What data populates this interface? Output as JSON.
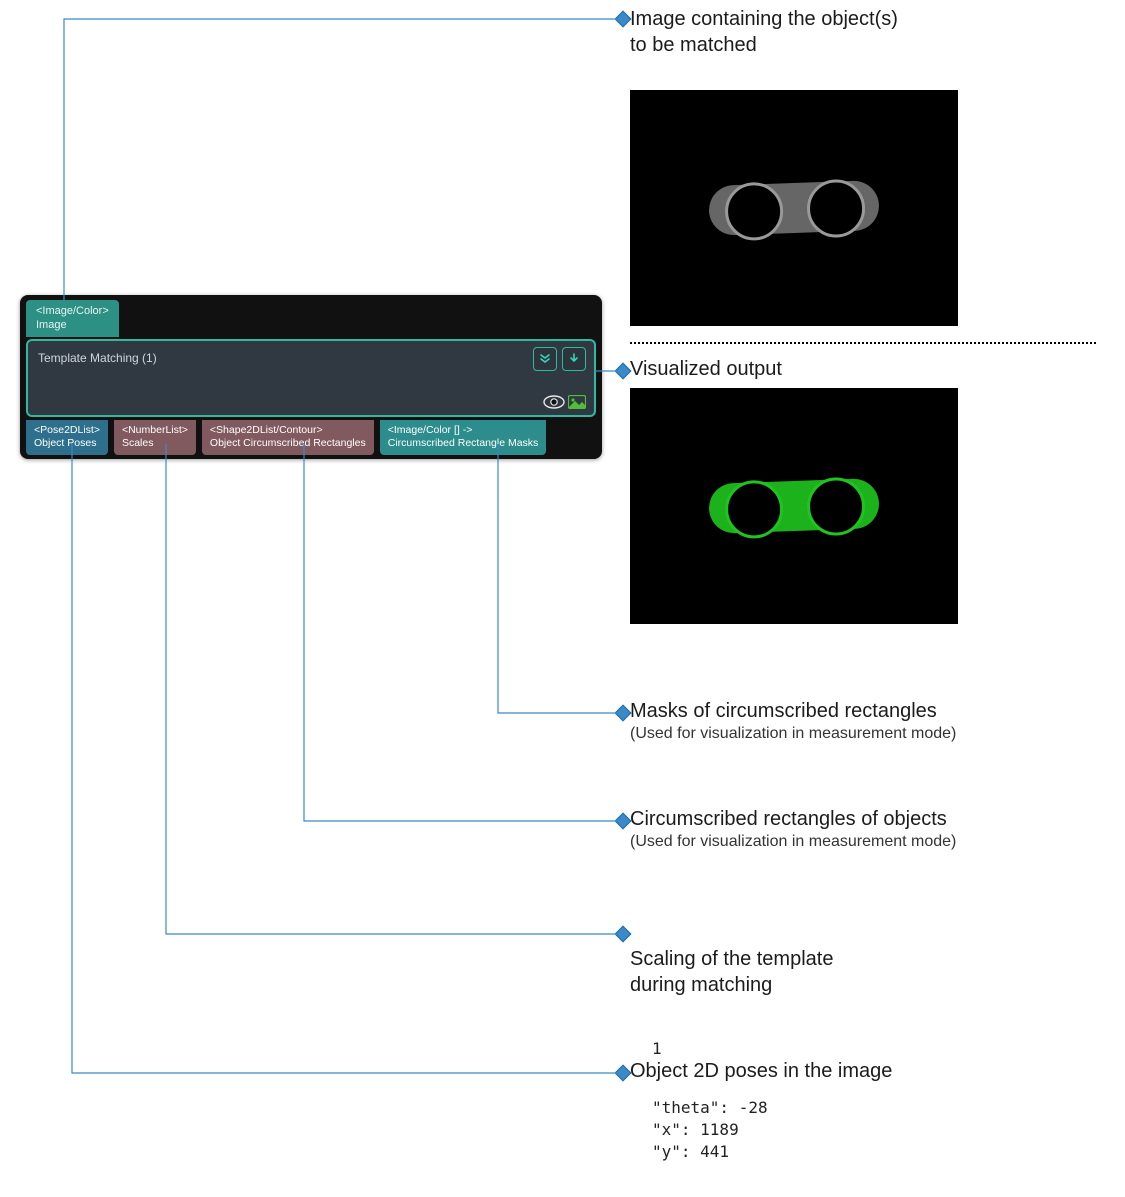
{
  "node": {
    "input": {
      "type": "<Image/Color>",
      "label": "Image"
    },
    "title": "Template Matching (1)",
    "outputs": [
      {
        "type": "<Pose2DList>",
        "label": "Object Poses"
      },
      {
        "type": "<NumberList>",
        "label": "Scales"
      },
      {
        "type": "<Shape2DList/Contour>",
        "label": "Object Circumscribed Rectangles"
      },
      {
        "type": "<Image/Color [] ->",
        "label": "Circumscribed Rectangle Masks"
      }
    ]
  },
  "annotations": {
    "input_desc": "Image containing the object(s)\nto be matched",
    "vis_output": "Visualized output",
    "masks": {
      "title": "Masks of circumscribed rectangles",
      "sub": "(Used for visualization in measurement mode)"
    },
    "rects": {
      "title": "Circumscribed rectangles of objects",
      "sub": "(Used for visualization in measurement mode)"
    },
    "scaling": {
      "title": "Scaling of the template\nduring matching",
      "value": "1"
    },
    "poses": {
      "title": "Object 2D poses in the image",
      "lines": [
        "\"theta\": -28",
        "\"x\": 1189",
        "\"y\": 441"
      ]
    }
  }
}
